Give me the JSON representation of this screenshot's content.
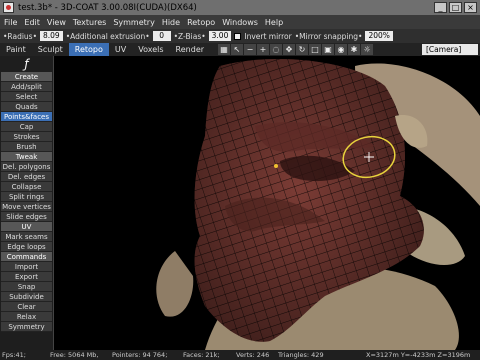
{
  "window": {
    "title": "test.3b* - 3D-COAT 3.00.08I(CUDA)(DX64)"
  },
  "menu": [
    "File",
    "Edit",
    "View",
    "Textures",
    "Symmetry",
    "Hide",
    "Retopo",
    "Windows",
    "Help"
  ],
  "options": {
    "radius_label": "•Radius•",
    "radius_value": "8.09",
    "extrusion_label": "•Additional extrusion•",
    "extrusion_value": "0",
    "zbias_label": "•Z-Bias•",
    "zbias_value": "3.00",
    "invert_label": "Invert mirror",
    "mirror_label": "•Mirror snapping•",
    "mirror_value": "200%"
  },
  "tabs": [
    {
      "label": "Paint",
      "active": false
    },
    {
      "label": "Sculpt",
      "active": false
    },
    {
      "label": "Retopo",
      "active": true
    },
    {
      "label": "UV",
      "active": false
    },
    {
      "label": "Voxels",
      "active": false
    },
    {
      "label": "Render",
      "active": false
    }
  ],
  "toolbar_icons": [
    "grid-icon",
    "cursor-icon",
    "minus-icon",
    "plus-icon",
    "lasso-icon",
    "move-icon",
    "rotate-icon",
    "square-icon",
    "frame-icon",
    "eye-icon",
    "star-icon",
    "sun-icon"
  ],
  "camera_label": "[Camera]",
  "tools": [
    {
      "label": "Create",
      "kind": "header"
    },
    {
      "label": "Add/split",
      "kind": "item"
    },
    {
      "label": "Select",
      "kind": "item"
    },
    {
      "label": "Quads",
      "kind": "item"
    },
    {
      "label": "Points&faces",
      "kind": "active"
    },
    {
      "label": "Cap",
      "kind": "item"
    },
    {
      "label": "Strokes",
      "kind": "item"
    },
    {
      "label": "Brush",
      "kind": "item"
    },
    {
      "label": "Tweak",
      "kind": "header"
    },
    {
      "label": "Del. polygons",
      "kind": "item"
    },
    {
      "label": "Del. edges",
      "kind": "item"
    },
    {
      "label": "Collapse",
      "kind": "item"
    },
    {
      "label": "Split rings",
      "kind": "item"
    },
    {
      "label": "Move vertices",
      "kind": "item"
    },
    {
      "label": "Slide edges",
      "kind": "item"
    },
    {
      "label": "UV",
      "kind": "header"
    },
    {
      "label": "Mark seams",
      "kind": "item"
    },
    {
      "label": "Edge loops",
      "kind": "item"
    },
    {
      "label": "Commands",
      "kind": "header"
    },
    {
      "label": "Import",
      "kind": "item"
    },
    {
      "label": "Export",
      "kind": "item"
    },
    {
      "label": "Snap",
      "kind": "item"
    },
    {
      "label": "Subdivide",
      "kind": "item"
    },
    {
      "label": "Clear",
      "kind": "item"
    },
    {
      "label": "Relax",
      "kind": "item"
    },
    {
      "label": "Symmetry",
      "kind": "item"
    }
  ],
  "status": {
    "fps": "Fps:41;",
    "free": "Free: 5064 Mb,",
    "pointers": "Pointers: 94 764;",
    "faces": "Faces: 21k;",
    "verts": "Verts: 246",
    "triangles": "Triangles: 429",
    "coords": "X=3127m Y=-4233m Z=3196m"
  },
  "colors": {
    "accent": "#3b6fb5",
    "mesh": "#7a3b34",
    "clay": "#a59276"
  }
}
